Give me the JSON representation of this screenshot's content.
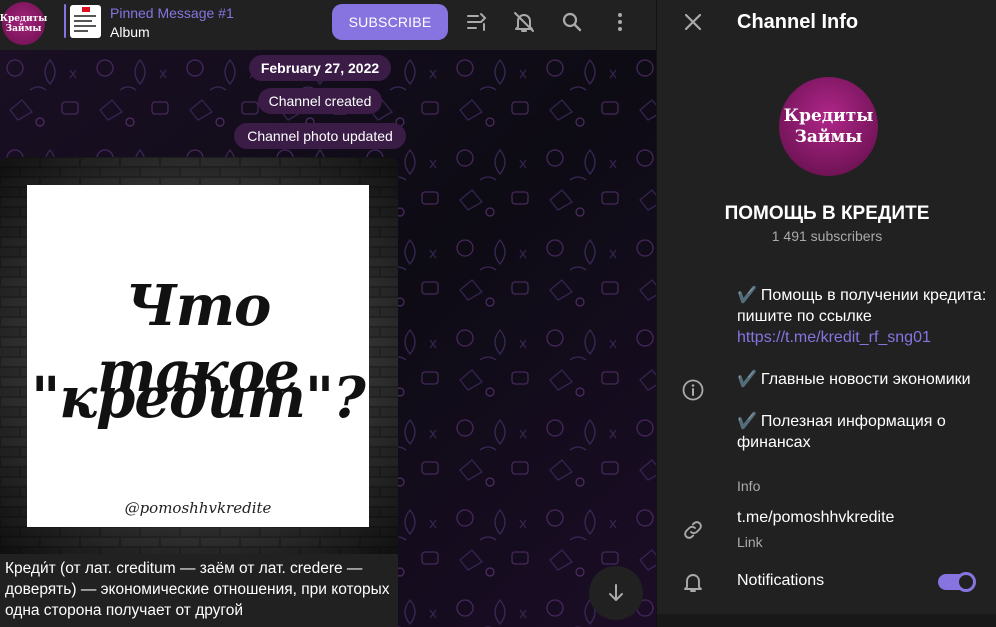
{
  "header": {
    "avatar_line1": "Кредиты",
    "avatar_line2": "Займы",
    "pinned_title": "Pinned Message #1",
    "pinned_subtitle": "Album",
    "subscribe_label": "SUBSCRIBE",
    "icons": [
      "filter-icon",
      "mute-bell-icon",
      "search-icon",
      "more-vertical-icon"
    ]
  },
  "chat": {
    "date_pill": "February 27, 2022",
    "service_1": "Channel created",
    "service_2": "Channel photo updated",
    "image_line1": "Что такое",
    "image_line2": "\"кредит\"?",
    "image_watermark": "@pomoshhvkredite",
    "message_text": "Креди́т (от лат. creditum — заём от лат. credere — доверять) — экономические отношения, при которых одна сторона получает от другой"
  },
  "info_panel": {
    "title": "Channel Info",
    "avatar_line1": "Кредиты",
    "avatar_line2": "Займы",
    "channel_name": "ПОМОЩЬ В КРЕДИТЕ",
    "subscribers": "1 491 subscribers",
    "desc_check": "✔️",
    "desc_1": "Помощь в получении кредита: пишите по ссылке",
    "desc_1_link": "https://t.me/kredit_rf_sng01",
    "desc_2": "Главные новости экономики",
    "desc_3": "Полезная информация о финансах",
    "info_label": "Info",
    "link_value": "t.me/pomoshhvkredite",
    "link_label": "Link",
    "notifications_label": "Notifications",
    "notifications_on": true
  },
  "colors": {
    "accent": "#8774e1",
    "panel_bg": "#212121",
    "pill_bg": "#3a1c46"
  }
}
